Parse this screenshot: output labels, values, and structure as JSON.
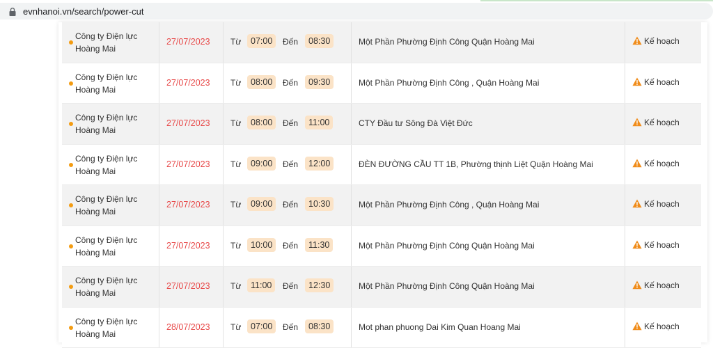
{
  "browser": {
    "url": "evnhanoi.vn/search/power-cut"
  },
  "labels": {
    "from": "Từ",
    "to": "Đến"
  },
  "rows": [
    {
      "company_line1": "Công ty Điện lực",
      "company_line2": "Hoàng Mai",
      "date": "27/07/2023",
      "start": "07:00",
      "end": "08:30",
      "area": "Một Phần Phường Định Công Quận Hoàng Mai",
      "status": "Kế hoạch"
    },
    {
      "company_line1": "Công ty Điện lực",
      "company_line2": "Hoàng Mai",
      "date": "27/07/2023",
      "start": "08:00",
      "end": "09:30",
      "area": "Một Phần Phường Định Công , Quận Hoàng Mai",
      "status": "Kế hoạch"
    },
    {
      "company_line1": "Công ty Điện lực",
      "company_line2": "Hoàng Mai",
      "date": "27/07/2023",
      "start": "08:00",
      "end": "11:00",
      "area": "CTY Đầu tư Sông Đà Việt Đức",
      "status": "Kế hoạch"
    },
    {
      "company_line1": "Công ty Điện lực",
      "company_line2": "Hoàng Mai",
      "date": "27/07/2023",
      "start": "09:00",
      "end": "12:00",
      "area": "ĐÈN ĐƯỜNG CẦU TT 1B, Phường thịnh Liệt Quận Hoàng Mai",
      "status": "Kế hoạch"
    },
    {
      "company_line1": "Công ty Điện lực",
      "company_line2": "Hoàng Mai",
      "date": "27/07/2023",
      "start": "09:00",
      "end": "10:30",
      "area": "Một Phần Phường Định Công , Quận Hoàng Mai",
      "status": "Kế hoạch"
    },
    {
      "company_line1": "Công ty Điện lực",
      "company_line2": "Hoàng Mai",
      "date": "27/07/2023",
      "start": "10:00",
      "end": "11:30",
      "area": "Một Phần Phường Định Công Quận Hoàng Mai",
      "status": "Kế hoạch"
    },
    {
      "company_line1": "Công ty Điện lực",
      "company_line2": "Hoàng Mai",
      "date": "27/07/2023",
      "start": "11:00",
      "end": "12:30",
      "area": "Một Phần Phường Định Công Quận Hoàng Mai",
      "status": "Kế hoạch"
    },
    {
      "company_line1": "Công ty Điện lực",
      "company_line2": "Hoàng Mai",
      "date": "28/07/2023",
      "start": "07:00",
      "end": "08:30",
      "area": "Mot phan phuong Dai Kim Quan Hoang Mai",
      "status": "Kế hoạch"
    }
  ],
  "colors": {
    "date": "#e84a4a",
    "dot": "#f39c12",
    "time_badge": "#fbe3c7",
    "warning_icon": "#f08c1a"
  }
}
